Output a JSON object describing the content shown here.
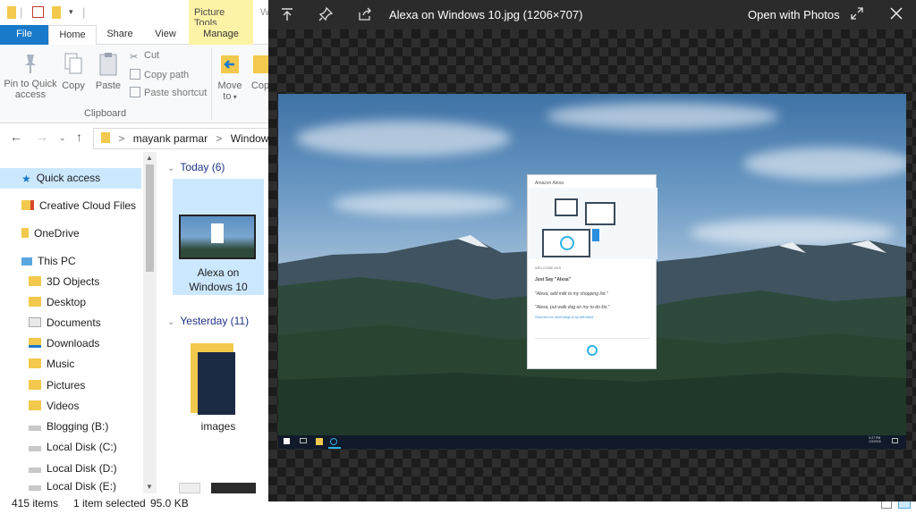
{
  "explorer": {
    "picture_tools": "Picture Tools",
    "window_title_fragment": "W",
    "tabs": [
      "File",
      "Home",
      "Share",
      "View",
      "Manage"
    ],
    "ribbon": {
      "pin_label": "Pin to Quick access",
      "copy_label": "Copy",
      "paste_label": "Paste",
      "cut_label": "Cut",
      "copy_path_label": "Copy path",
      "paste_shortcut_label": "Paste shortcut",
      "clipboard_group": "Clipboard",
      "move_to_label": "Move to",
      "copy_to_label": "Cop"
    },
    "address": {
      "crumbs": [
        "mayank parmar",
        "Windows L"
      ],
      "separator": ">"
    },
    "nav_items": [
      {
        "label": "Quick access",
        "icon": "star-icon",
        "selected": true
      },
      {
        "label": "Creative Cloud Files",
        "icon": "cloud-folder-icon"
      },
      {
        "label": "OneDrive",
        "icon": "folder-icon"
      },
      {
        "label": "This PC",
        "icon": "computer-icon"
      },
      {
        "label": "3D Objects",
        "icon": "folder-icon"
      },
      {
        "label": "Desktop",
        "icon": "folder-icon"
      },
      {
        "label": "Documents",
        "icon": "documents-icon"
      },
      {
        "label": "Downloads",
        "icon": "downloads-icon"
      },
      {
        "label": "Music",
        "icon": "music-icon"
      },
      {
        "label": "Pictures",
        "icon": "pictures-icon"
      },
      {
        "label": "Videos",
        "icon": "videos-icon"
      },
      {
        "label": "Blogging (B:)",
        "icon": "drive-icon"
      },
      {
        "label": "Local Disk (C:)",
        "icon": "drive-icon"
      },
      {
        "label": "Local Disk (D:)",
        "icon": "drive-icon"
      },
      {
        "label": "Local Disk (E:)",
        "icon": "drive-icon"
      }
    ],
    "groups": {
      "today": "Today (6)",
      "yesterday": "Yesterday (11)"
    },
    "files": {
      "alexa_line1": "Alexa on",
      "alexa_line2": "Windows 10",
      "images": "images"
    },
    "status": {
      "count": "415 items",
      "selection": "1 item selected",
      "size": "95.0 KB"
    }
  },
  "viewer": {
    "title": "Alexa on Windows 10.jpg (1206×707)",
    "open_with": "Open with Photos",
    "icons": [
      "upload-icon",
      "pin-icon",
      "share-icon",
      "fullscreen-icon",
      "close-icon"
    ],
    "alexa_window": {
      "app_name": "Amazon Alexa",
      "welcome": "WELCOME AVS",
      "heading": "Just Say \"Alexa\"",
      "example1": "\"Alexa, add milk to my shopping list.\"",
      "example2": "\"Alexa, put walk dog on my to-do list.\"",
      "link": "Click here for more things to try with Alexa"
    },
    "taskbar_time": "5:27 PM",
    "taskbar_date": "1/3/2018"
  }
}
